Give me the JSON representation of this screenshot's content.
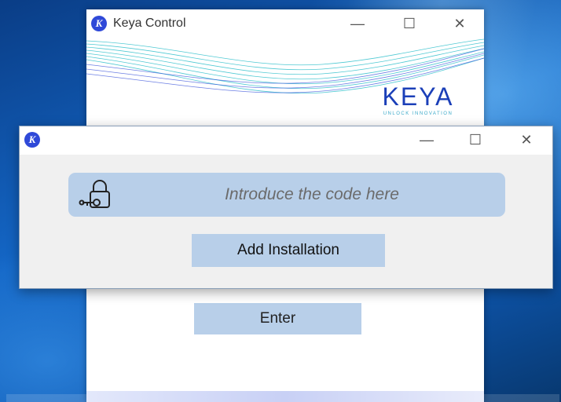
{
  "background_window": {
    "title": "Keya Control",
    "icon_letter": "K",
    "logo": {
      "text": "KEYA",
      "tagline": "UNLOCK INNOVATION"
    },
    "enter_label": "Enter"
  },
  "dialog": {
    "icon_letter": "K",
    "code_input": {
      "placeholder": "Introduce the code here",
      "value": ""
    },
    "add_label": "Add Installation"
  },
  "controls": {
    "minimize": "—",
    "maximize": "☐",
    "close": "✕"
  },
  "colors": {
    "accent": "#2f49d8",
    "button": "#b8cfe9",
    "dialog_bg": "#f0f0f0",
    "logo": "#1b3fb8",
    "wave": "#3ec4cf"
  },
  "icons": {
    "app": "keya-logo-icon",
    "lock": "padlock-key-icon"
  }
}
